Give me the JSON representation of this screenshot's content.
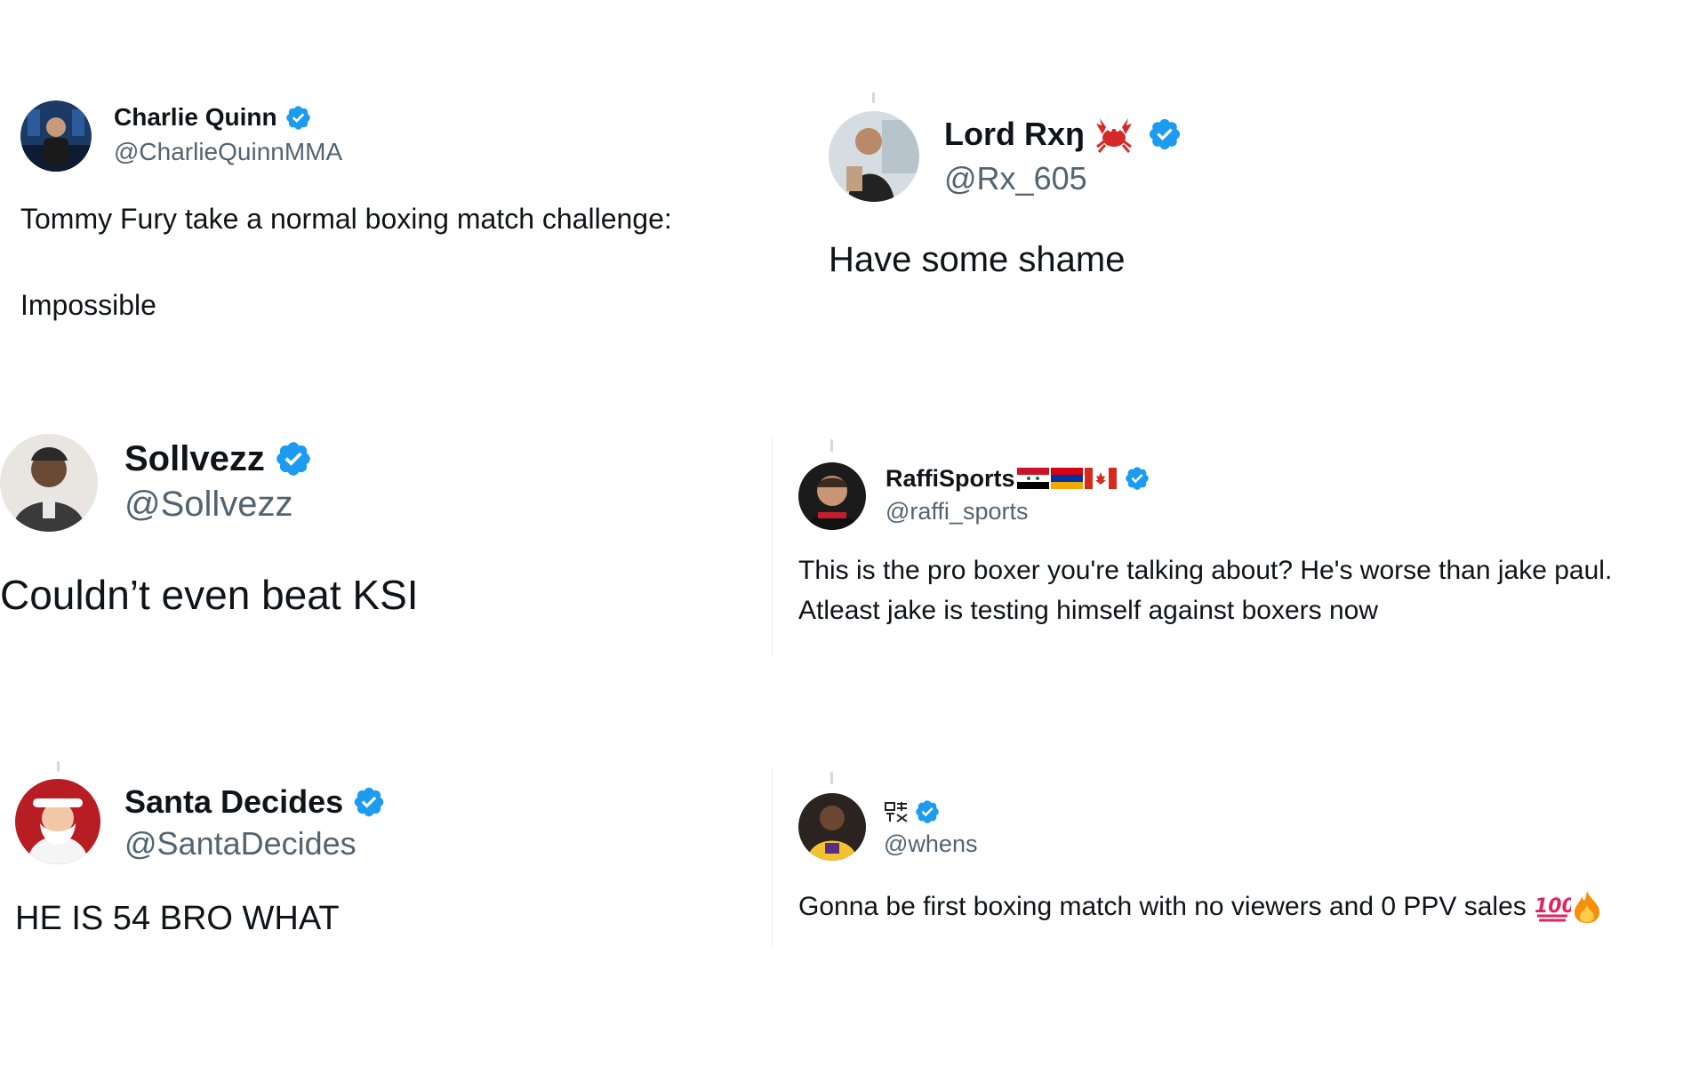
{
  "tweets": [
    {
      "name": "Charlie Quinn",
      "handle": "@CharlieQuinnMMA",
      "lines": [
        "Tommy Fury take a normal boxing match challenge:",
        "Impossible"
      ]
    },
    {
      "name": "Lord Rxŋ",
      "name_emoji": "crab-emoji",
      "handle": "@Rx_605",
      "lines": [
        "Have some shame"
      ]
    },
    {
      "name": "Sollvezz",
      "handle": "@Sollvezz",
      "lines": [
        "Couldn’t even beat KSI"
      ]
    },
    {
      "name": "RaffiSports",
      "name_emoji": [
        "flag-syria",
        "flag-armenia",
        "flag-canada"
      ],
      "handle": "@raffi_sports",
      "lines": [
        "This is the pro boxer you're talking about? He's worse than jake paul.",
        "Atleast jake is testing himself against boxers now"
      ]
    },
    {
      "name": "Santa Decides",
      "handle": "@SantaDecides",
      "lines": [
        "HE IS 54 BRO WHAT"
      ]
    },
    {
      "name_emoji": "japanese-ogre-glyph",
      "handle": "@whens",
      "lines": [
        "Gonna be first boxing match with no viewers and 0 PPV sales"
      ],
      "trailing_emoji": [
        "hundred-points-emoji",
        "fire-emoji"
      ]
    }
  ],
  "colors": {
    "verified": "#1d9bf0",
    "text": "#0f1419",
    "handle": "#536471",
    "thread_line": "#cfd9de"
  }
}
